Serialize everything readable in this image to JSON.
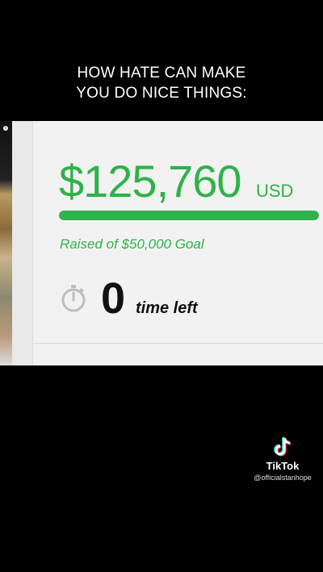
{
  "caption": {
    "line1": "HOW HATE CAN MAKE",
    "line2": "YOU DO NICE THINGS:"
  },
  "fundraiser": {
    "amount_raised": "$125,760",
    "currency": "USD",
    "goal_text": "Raised of $50,000 Goal",
    "progress_fraction": 1.0,
    "progress_color": "#2fb24a",
    "time_value": "0",
    "time_label": "time left",
    "timer_icon": "stopwatch-icon"
  },
  "watermark": {
    "app_name": "TikTok",
    "handle": "@officialstanhope",
    "logo_icon": "tiktok-logo-icon"
  }
}
